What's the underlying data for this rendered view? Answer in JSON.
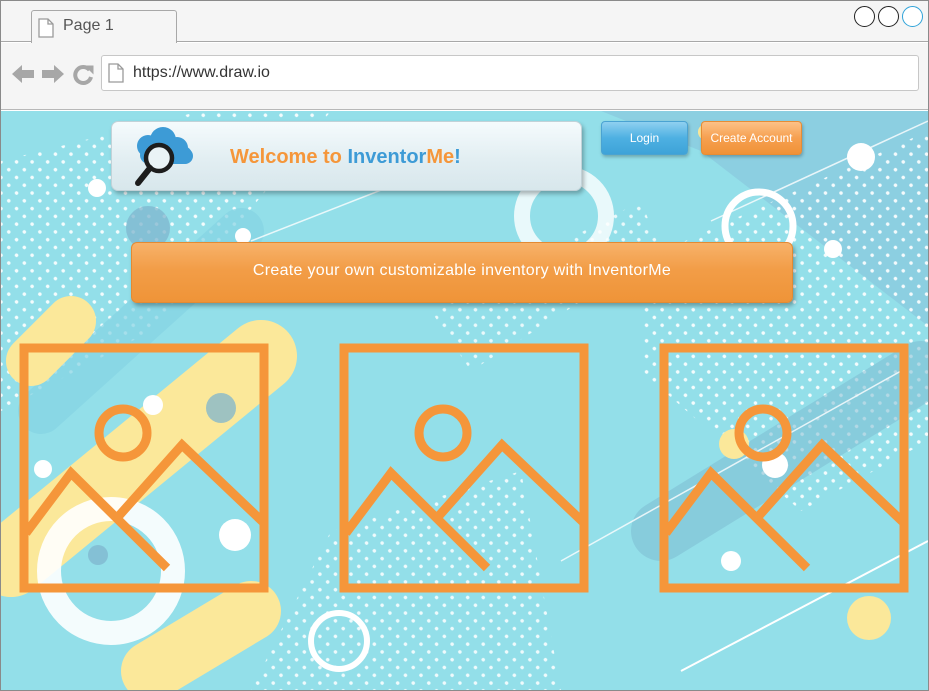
{
  "browser": {
    "tab_title": "Page 1",
    "url": "https://www.draw.io",
    "window_controls": [
      "minimize-control",
      "maximize-control",
      "close-control"
    ],
    "nav_icons": [
      "back-arrow-icon",
      "forward-arrow-icon",
      "reload-icon"
    ]
  },
  "header": {
    "welcome_part1": "Welcome to ",
    "welcome_part2": "Inventor",
    "welcome_part3": "Me",
    "welcome_part4": "!",
    "logo_icon": "search-cloud-icon",
    "login_label": "Login",
    "create_account_label": "Create Account"
  },
  "banner": {
    "text": "Create your own customizable inventory with InventorMe"
  },
  "image_placeholders": [
    "image-placeholder-icon",
    "image-placeholder-icon",
    "image-placeholder-icon"
  ],
  "colors": {
    "accent_orange": "#f5963a",
    "accent_blue": "#3d9bd6",
    "background": "#93dfe9",
    "login_button": "#4eb0e2",
    "create_button": "#f6a050"
  }
}
